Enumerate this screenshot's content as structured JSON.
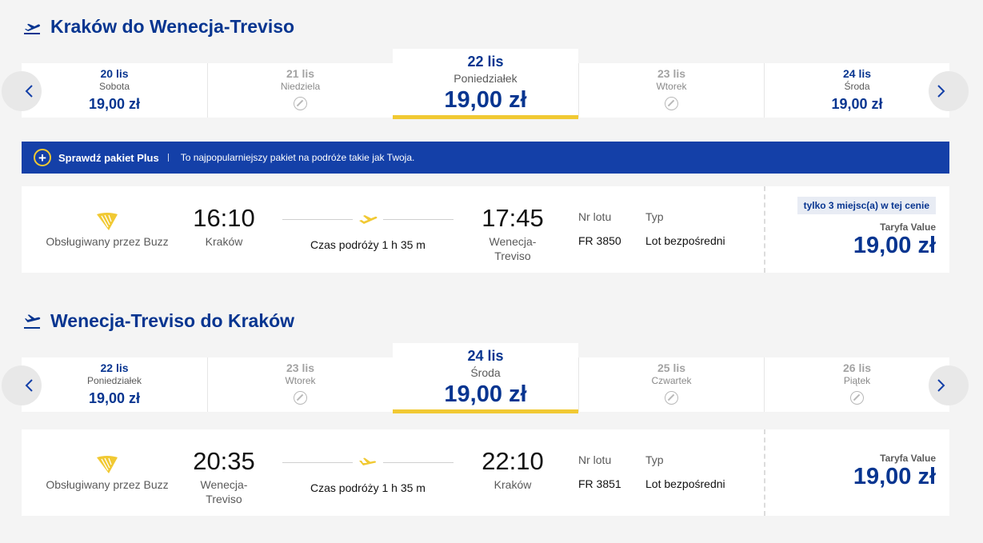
{
  "outbound": {
    "title": "Kraków do Wenecja-Treviso",
    "dates": [
      {
        "date": "20 lis",
        "weekday": "Sobota",
        "price": "19,00 zł",
        "state": "available"
      },
      {
        "date": "21 lis",
        "weekday": "Niedziela",
        "price": "",
        "state": "disabled"
      },
      {
        "date": "22 lis",
        "weekday": "Poniedziałek",
        "price": "19,00 zł",
        "state": "selected"
      },
      {
        "date": "23 lis",
        "weekday": "Wtorek",
        "price": "",
        "state": "disabled"
      },
      {
        "date": "24 lis",
        "weekday": "Środa",
        "price": "19,00 zł",
        "state": "available"
      }
    ],
    "flight": {
      "operator": "Obsługiwany przez Buzz",
      "depart_time": "16:10",
      "depart_city": "Kraków",
      "duration": "Czas podróży 1 h 35 m",
      "arrive_time": "17:45",
      "arrive_city": "Wenecja-\nTreviso",
      "flight_no_label": "Nr lotu",
      "flight_no": "FR 3850",
      "type_label": "Typ",
      "type": "Lot bezpośredni",
      "seats_badge": "tylko 3 miejsc(a) w tej cenie",
      "fare_label": "Taryfa Value",
      "price": "19,00 zł"
    }
  },
  "banner": {
    "title": "Sprawdź pakiet Plus",
    "description": "To najpopularniejszy pakiet na podróże takie jak Twoja."
  },
  "return": {
    "title": "Wenecja-Treviso do Kraków",
    "dates": [
      {
        "date": "22 lis",
        "weekday": "Poniedziałek",
        "price": "19,00 zł",
        "state": "available"
      },
      {
        "date": "23 lis",
        "weekday": "Wtorek",
        "price": "",
        "state": "disabled"
      },
      {
        "date": "24 lis",
        "weekday": "Środa",
        "price": "19,00 zł",
        "state": "selected"
      },
      {
        "date": "25 lis",
        "weekday": "Czwartek",
        "price": "",
        "state": "disabled"
      },
      {
        "date": "26 lis",
        "weekday": "Piątek",
        "price": "",
        "state": "disabled"
      }
    ],
    "flight": {
      "operator": "Obsługiwany przez Buzz",
      "depart_time": "20:35",
      "depart_city": "Wenecja-\nTreviso",
      "duration": "Czas podróży 1 h 35 m",
      "arrive_time": "22:10",
      "arrive_city": "Kraków",
      "flight_no_label": "Nr lotu",
      "flight_no": "FR 3851",
      "type_label": "Typ",
      "type": "Lot bezpośredni",
      "fare_label": "Taryfa Value",
      "price": "19,00 zł"
    }
  },
  "colors": {
    "brand_blue": "#073590",
    "banner_blue": "#1440a8",
    "accent_yellow": "#f1c933"
  },
  "icons": {
    "takeoff": "plane-takeoff-icon",
    "landing": "plane-landing-icon",
    "no_flight": "no-flight-icon",
    "operator_logo": "ryanair-harp-logo"
  }
}
